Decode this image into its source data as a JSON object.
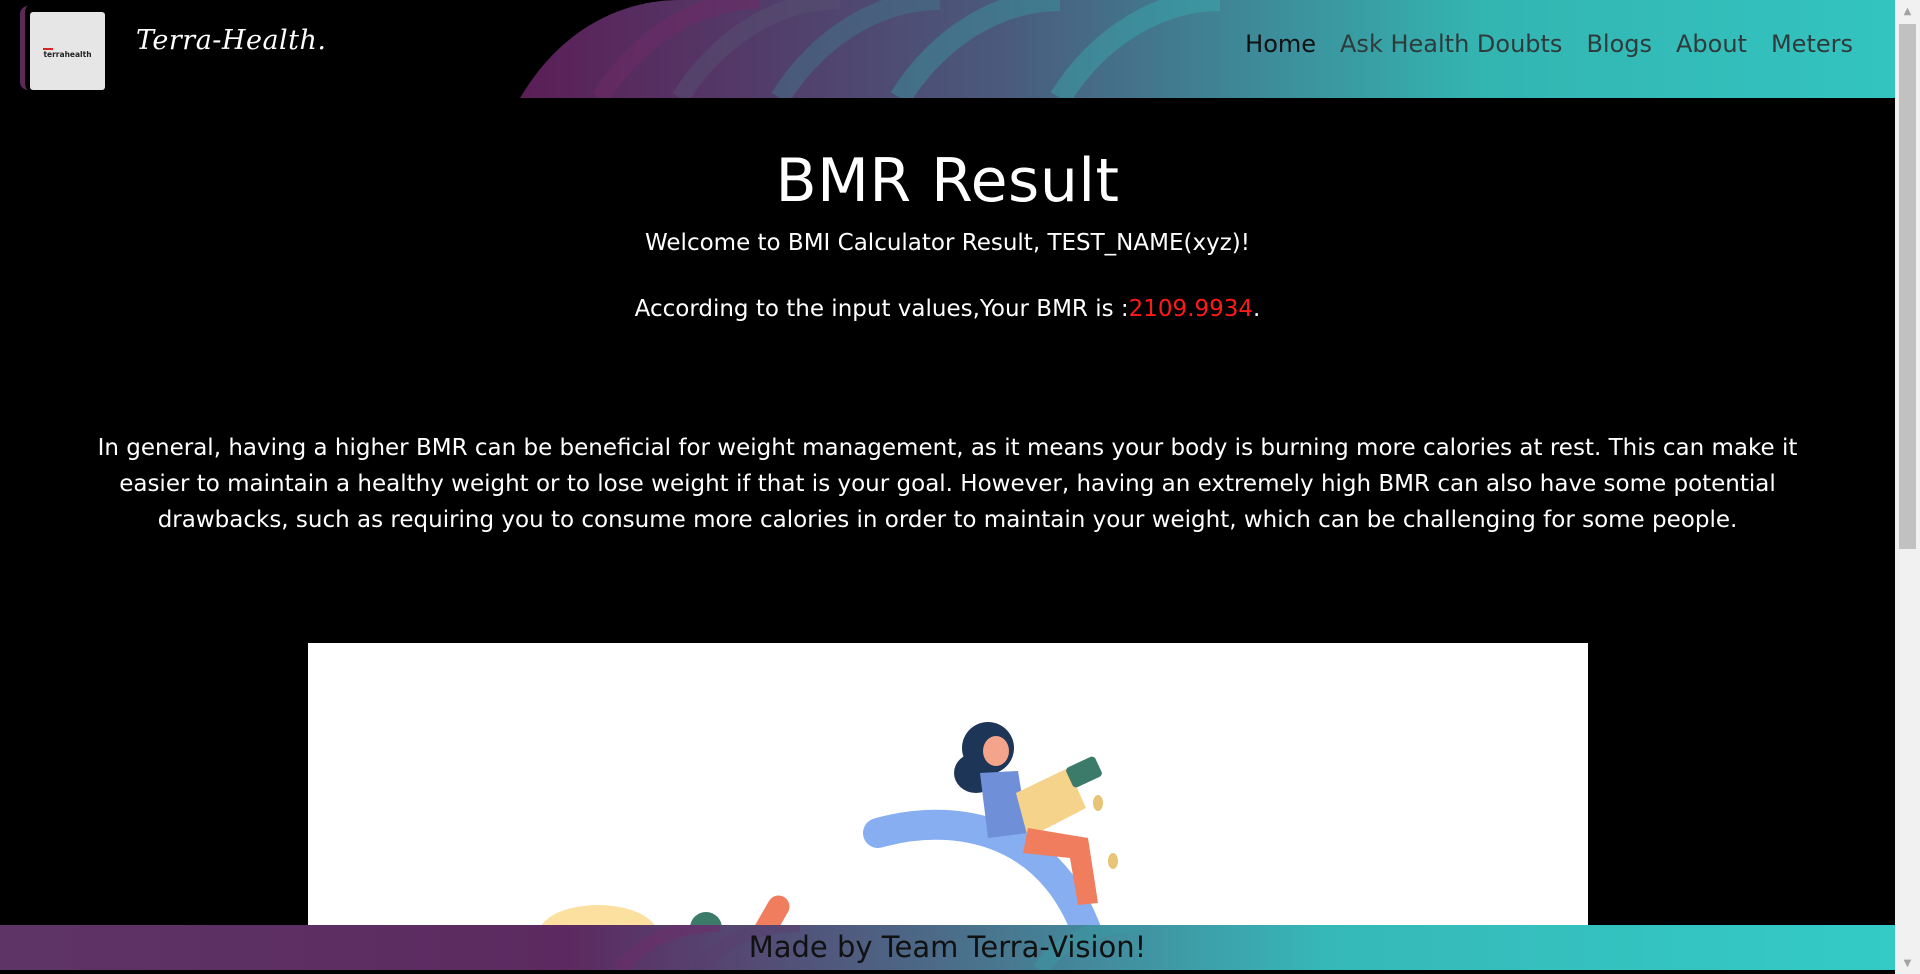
{
  "header": {
    "logo_text": "terrahealth",
    "brand": "Terra-Health.",
    "nav": [
      {
        "label": "Home"
      },
      {
        "label": "Ask Health Doubts"
      },
      {
        "label": "Blogs"
      },
      {
        "label": "About"
      },
      {
        "label": "Meters"
      }
    ]
  },
  "main": {
    "title": "BMR Result",
    "welcome": "Welcome to BMI Calculator Result, TEST_NAME(xyz)!",
    "result_prefix": "According to the input values,Your BMR is :",
    "bmr_value": "2109.9934",
    "result_suffix": ".",
    "description": "In general, having a higher BMR can be beneficial for weight management, as it means your body is burning more calories at rest. This can make it easier to maintain a healthy weight or to lose weight if that is your goal. However, having an extremely high BMR can also have some potential drawbacks, such as requiring you to consume more calories in order to maintain your weight, which can be challenging for some people."
  },
  "footer": {
    "text": "Made by Team Terra-Vision!"
  },
  "colors": {
    "accent_teal": "#33c4c0",
    "accent_purple": "#5b2a55",
    "value_red": "#ff1a1a"
  }
}
